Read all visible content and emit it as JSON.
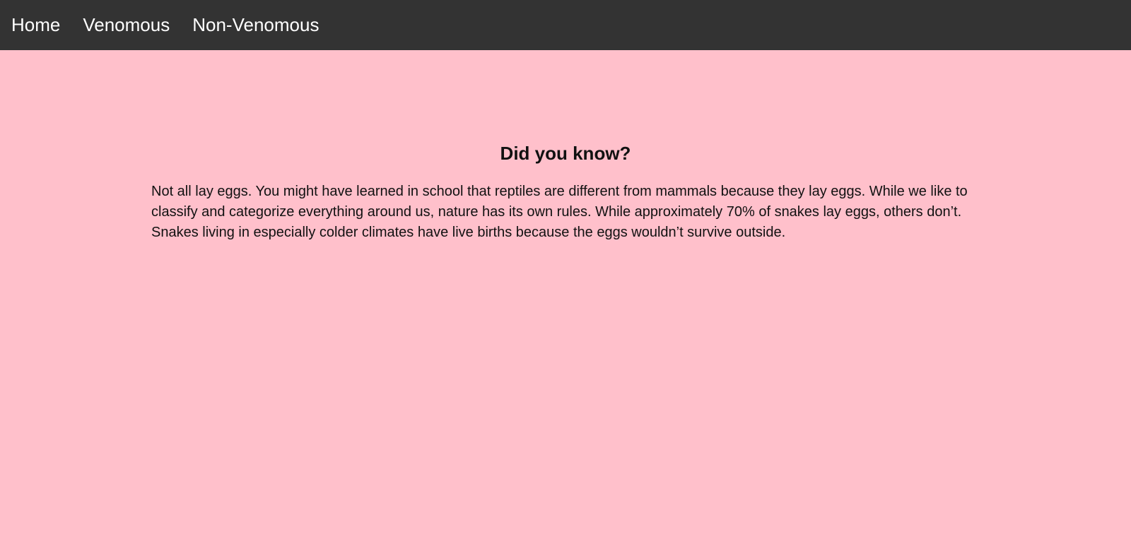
{
  "theme": {
    "background": "#ffc0cb",
    "nav_background": "#333333",
    "nav_text": "#ffffff",
    "body_text": "#111111"
  },
  "nav": {
    "items": [
      {
        "label": "Home"
      },
      {
        "label": "Venomous"
      },
      {
        "label": "Non-Venomous"
      }
    ]
  },
  "main": {
    "title": "Did you know?",
    "paragraph": "Not all lay eggs. You might have learned in school that reptiles are different from mammals because they lay eggs. While we like to classify and categorize everything around us, nature has its own rules. While approximately 70% of snakes lay eggs, others don’t. Snakes living in especially colder climates have live births because the eggs wouldn’t survive outside."
  }
}
